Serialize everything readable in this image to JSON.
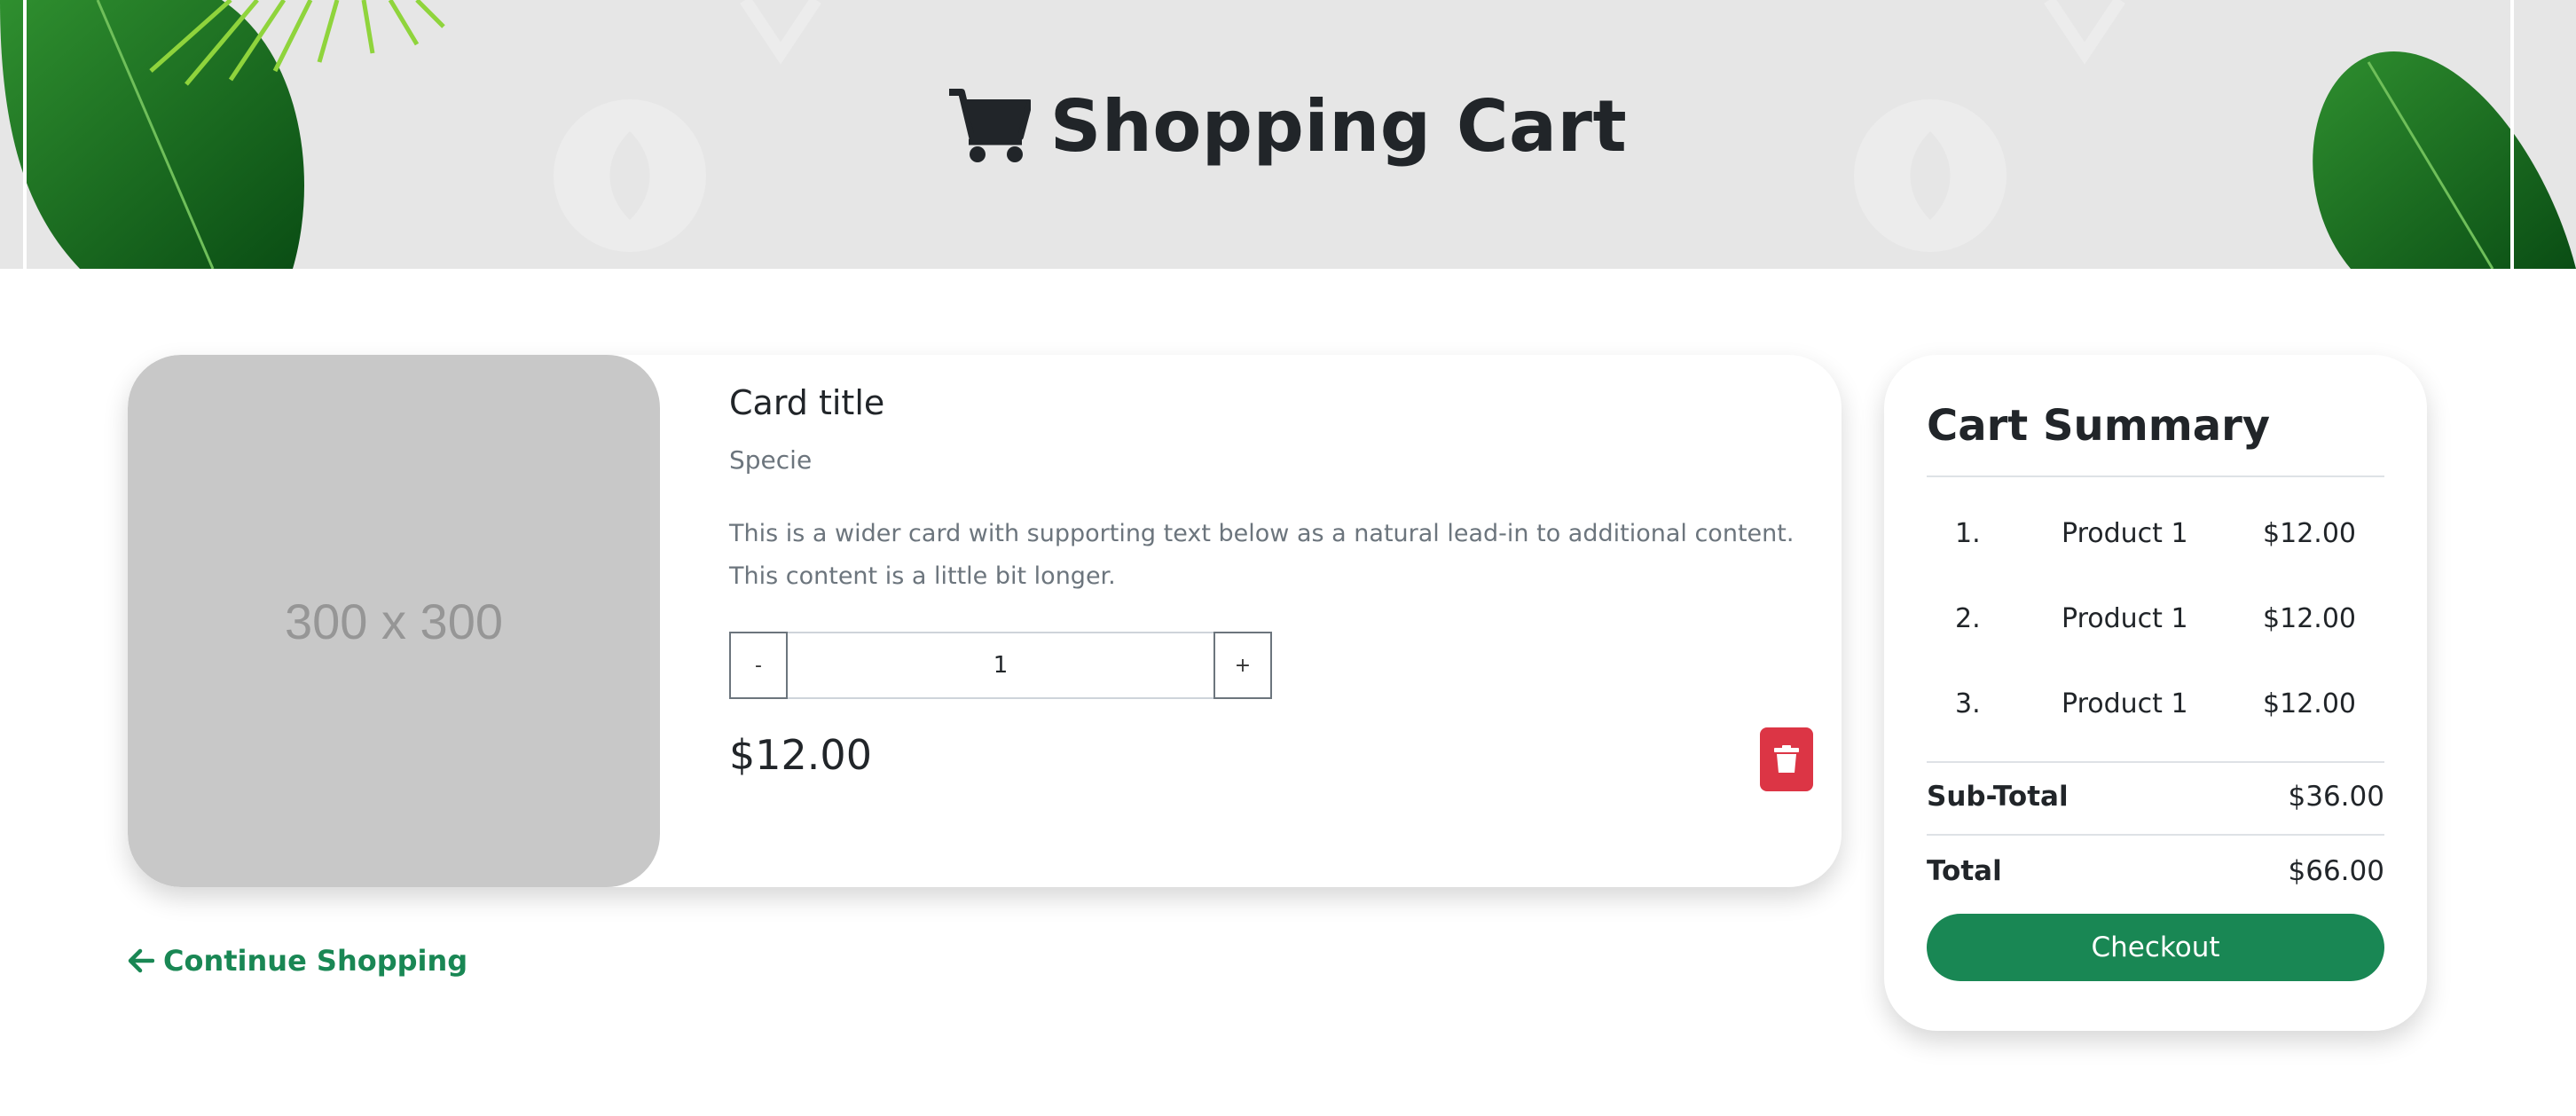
{
  "header": {
    "title": "Shopping Cart",
    "icon": "cart-icon",
    "background": "#e6e6e6"
  },
  "product": {
    "image_placeholder": "300 x 300",
    "title": "Card title",
    "subtitle": "Specie",
    "description": "This is a wider card with supporting text below as a natural lead-in to additional content. This content is a little bit longer.",
    "quantity": {
      "decrement_label": "-",
      "value": "1",
      "increment_label": "+"
    },
    "price": "$12.00",
    "delete_icon": "trash-icon",
    "delete_color": "#dc3545"
  },
  "continue_shopping": {
    "icon": "arrow-left-icon",
    "label": "Continue Shopping",
    "color": "#198754"
  },
  "summary": {
    "title": "Cart Summary",
    "items": [
      {
        "num": "1.",
        "name": "Product 1",
        "price": "$12.00"
      },
      {
        "num": "2.",
        "name": "Product 1",
        "price": "$12.00"
      },
      {
        "num": "3.",
        "name": "Product 1",
        "price": "$12.00"
      }
    ],
    "subtotal_label": "Sub-Total",
    "subtotal_value": "$36.00",
    "total_label": "Total",
    "total_value": "$66.00",
    "checkout_label": "Checkout",
    "checkout_color": "#198754"
  }
}
